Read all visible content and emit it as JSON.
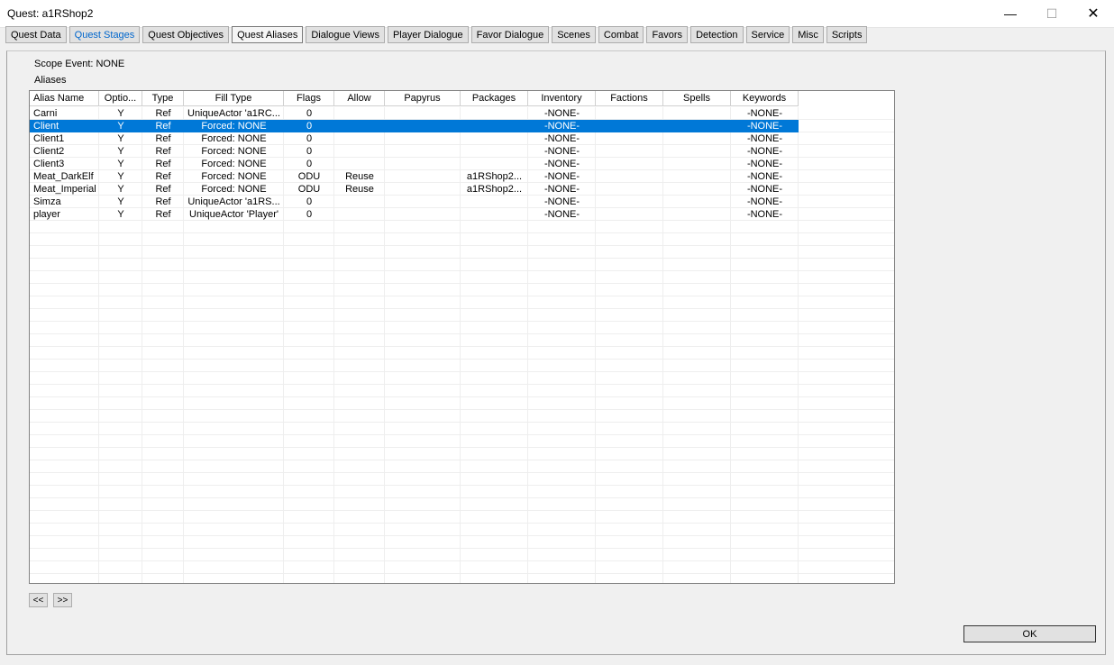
{
  "window": {
    "title": "Quest: a1RShop2"
  },
  "tabs": [
    {
      "label": "Quest Data"
    },
    {
      "label": "Quest Stages"
    },
    {
      "label": "Quest Objectives"
    },
    {
      "label": "Quest Aliases"
    },
    {
      "label": "Dialogue Views"
    },
    {
      "label": "Player Dialogue"
    },
    {
      "label": "Favor Dialogue"
    },
    {
      "label": "Scenes"
    },
    {
      "label": "Combat"
    },
    {
      "label": "Favors"
    },
    {
      "label": "Detection"
    },
    {
      "label": "Service"
    },
    {
      "label": "Misc"
    },
    {
      "label": "Scripts"
    }
  ],
  "scope_event": "Scope Event: NONE",
  "aliases_label": "Aliases",
  "table": {
    "columns": [
      "Alias Name",
      "Optio...",
      "Type",
      "Fill Type",
      "Flags",
      "Allow",
      "Papyrus",
      "Packages",
      "Inventory",
      "Factions",
      "Spells",
      "Keywords"
    ],
    "rows": [
      [
        "Carni",
        "Y",
        "Ref",
        "UniqueActor 'a1RC...",
        "0",
        "",
        "",
        "",
        "-NONE-",
        "",
        "",
        "-NONE-"
      ],
      [
        "Client",
        "Y",
        "Ref",
        "Forced: NONE",
        "0",
        "",
        "",
        "",
        "-NONE-",
        "",
        "",
        "-NONE-"
      ],
      [
        "Client1",
        "Y",
        "Ref",
        "Forced: NONE",
        "0",
        "",
        "",
        "",
        "-NONE-",
        "",
        "",
        "-NONE-"
      ],
      [
        "Client2",
        "Y",
        "Ref",
        "Forced: NONE",
        "0",
        "",
        "",
        "",
        "-NONE-",
        "",
        "",
        "-NONE-"
      ],
      [
        "Client3",
        "Y",
        "Ref",
        "Forced: NONE",
        "0",
        "",
        "",
        "",
        "-NONE-",
        "",
        "",
        "-NONE-"
      ],
      [
        "Meat_DarkElf",
        "Y",
        "Ref",
        "Forced: NONE",
        "ODU",
        "Reuse",
        "",
        "a1RShop2...",
        "-NONE-",
        "",
        "",
        "-NONE-"
      ],
      [
        "Meat_Imperial",
        "Y",
        "Ref",
        "Forced: NONE",
        "ODU",
        "Reuse",
        "",
        "a1RShop2...",
        "-NONE-",
        "",
        "",
        "-NONE-"
      ],
      [
        "Simza",
        "Y",
        "Ref",
        "UniqueActor 'a1RS...",
        "0",
        "",
        "",
        "",
        "-NONE-",
        "",
        "",
        "-NONE-"
      ],
      [
        "player",
        "Y",
        "Ref",
        "UniqueActor 'Player'",
        "0",
        "",
        "",
        "",
        "-NONE-",
        "",
        "",
        "-NONE-"
      ]
    ],
    "selected_row": 1
  },
  "nav": {
    "prev_label": "<<",
    "next_label": ">>"
  },
  "ok_label": "OK",
  "colors": {
    "selection": "#0078d7",
    "link": "#0066cc"
  }
}
